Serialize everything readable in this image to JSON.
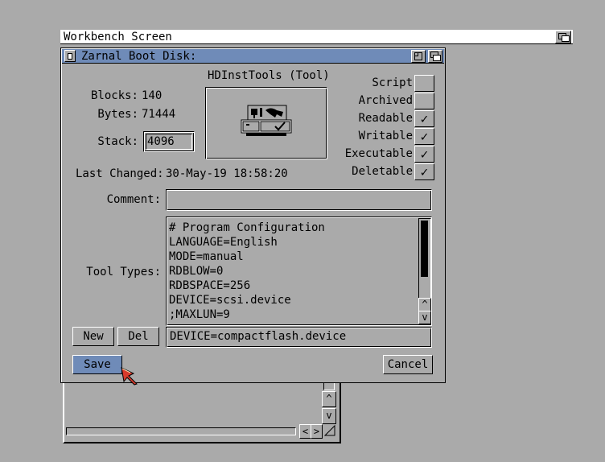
{
  "screen": {
    "title": "Workbench Screen"
  },
  "window": {
    "title": "Zarnal Boot Disk:"
  },
  "info": {
    "tool_title": "HDInstTools (Tool)",
    "blocks_label": "Blocks:",
    "blocks_value": "140",
    "bytes_label": "Bytes:",
    "bytes_value": "71444",
    "stack_label": "Stack:",
    "stack_value": "4096",
    "last_changed_label": "Last Changed:",
    "last_changed_value": "30-May-19 18:58:20",
    "comment_label": "Comment:",
    "comment_value": "",
    "tooltypes_label": "Tool Types:"
  },
  "flags": [
    {
      "label": "Script",
      "checked": false
    },
    {
      "label": "Archived",
      "checked": false
    },
    {
      "label": "Readable",
      "checked": true
    },
    {
      "label": "Writable",
      "checked": true
    },
    {
      "label": "Executable",
      "checked": true
    },
    {
      "label": "Deletable",
      "checked": true
    }
  ],
  "tooltypes": [
    "# Program Configuration",
    "LANGUAGE=English",
    "MODE=manual",
    "RDBLOW=0",
    "RDBSPACE=256",
    "DEVICE=scsi.device",
    ";MAXLUN=9"
  ],
  "tooltype_edit_value": "DEVICE=compactflash.device",
  "buttons": {
    "new": "New",
    "del": "Del",
    "save": "Save",
    "cancel": "Cancel"
  },
  "glyphs": {
    "check": "✓",
    "up": "^",
    "down": "v",
    "left": "<",
    "right": ">"
  },
  "colors": {
    "background": "#aaaaaa",
    "titlebar_active": "#6f8bb8",
    "save_button": "#6f8bb8"
  }
}
